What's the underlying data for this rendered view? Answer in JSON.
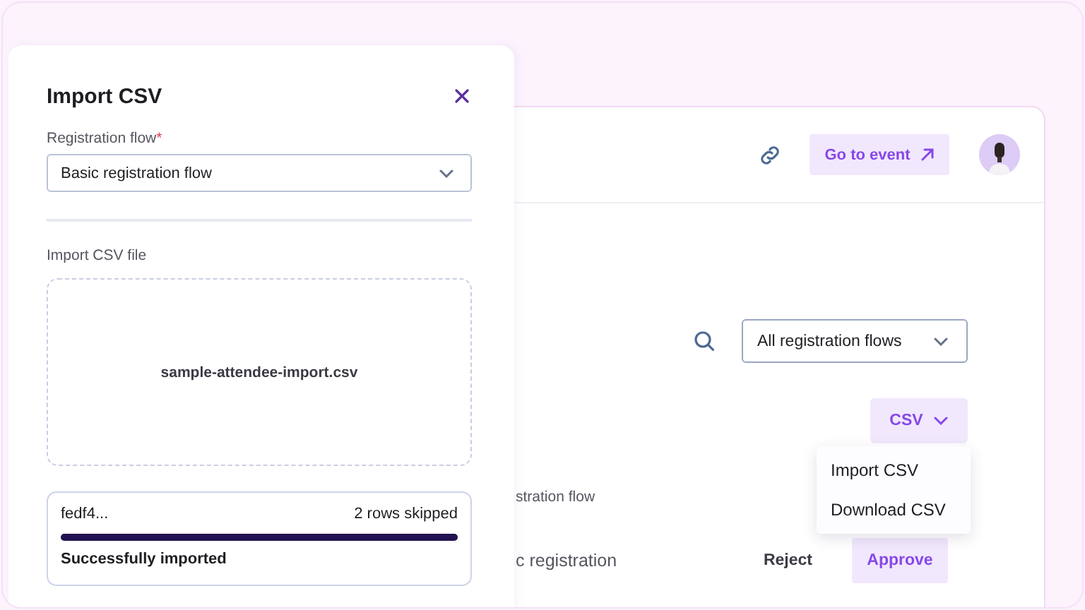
{
  "import_panel": {
    "title": "Import CSV",
    "flow_field": {
      "label": "Registration flow",
      "required_mark": "*",
      "value": "Basic registration flow"
    },
    "file_label": "Import CSV file",
    "file_name": "sample-attendee-import.csv",
    "result": {
      "file": "fedf4...",
      "skipped": "2 rows skipped",
      "level": 1,
      "status": "Successfully imported"
    }
  },
  "header": {
    "button": "Go to event"
  },
  "filters": {
    "value": "All registration flows"
  },
  "csv_button": "CSV",
  "csv_menu": [
    {
      "label": "Import CSV"
    },
    {
      "label": "Download CSV"
    }
  ],
  "column_text": "stration flow",
  "row": {
    "text": "c registration",
    "actions": [
      {
        "label": "Reject",
        "kind": "plain"
      },
      {
        "label": "Approve",
        "kind": "primary"
      }
    ]
  }
}
